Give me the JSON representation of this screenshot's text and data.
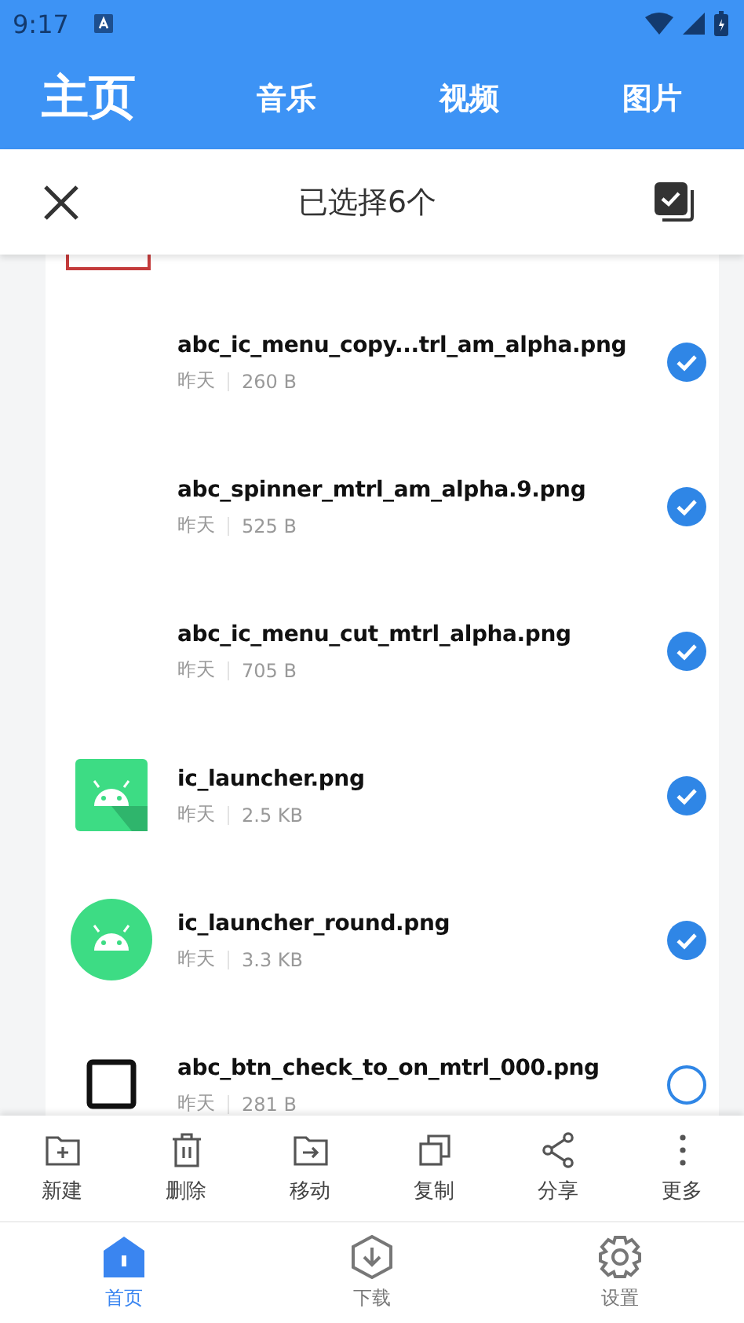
{
  "status_bar": {
    "time": "9:17"
  },
  "tabs": [
    {
      "label": "主页",
      "selected": true
    },
    {
      "label": "音乐",
      "selected": false
    },
    {
      "label": "视频",
      "selected": false
    },
    {
      "label": "图片",
      "selected": false
    }
  ],
  "selection_bar": {
    "title": "已选择6个"
  },
  "files": [
    {
      "name": "abc_ic_menu_copy...trl_am_alpha.png",
      "date": "昨天",
      "size": "260 B",
      "kind": "no-thumb",
      "selected": true
    },
    {
      "name": "abc_spinner_mtrl_am_alpha.9.png",
      "date": "昨天",
      "size": "525 B",
      "kind": "no-thumb",
      "selected": true
    },
    {
      "name": "abc_ic_menu_cut_mtrl_alpha.png",
      "date": "昨天",
      "size": "705 B",
      "kind": "no-thumb",
      "selected": true
    },
    {
      "name": "ic_launcher.png",
      "date": "昨天",
      "size": "2.5 KB",
      "kind": "android-square",
      "selected": true
    },
    {
      "name": "ic_launcher_round.png",
      "date": "昨天",
      "size": "3.3 KB",
      "kind": "android-round",
      "selected": true
    },
    {
      "name": "abc_btn_check_to_on_mtrl_000.png",
      "date": "昨天",
      "size": "281 B",
      "kind": "square-outline",
      "selected": false
    }
  ],
  "actions": [
    {
      "label": "新建",
      "kind": "new-folder"
    },
    {
      "label": "删除",
      "kind": "delete"
    },
    {
      "label": "移动",
      "kind": "move"
    },
    {
      "label": "复制",
      "kind": "copy"
    },
    {
      "label": "分享",
      "kind": "share"
    },
    {
      "label": "更多",
      "kind": "more"
    }
  ],
  "bottom_nav": [
    {
      "label": "首页",
      "kind": "home",
      "selected": true
    },
    {
      "label": "下载",
      "kind": "download",
      "selected": false
    },
    {
      "label": "设置",
      "kind": "settings",
      "selected": false
    }
  ]
}
